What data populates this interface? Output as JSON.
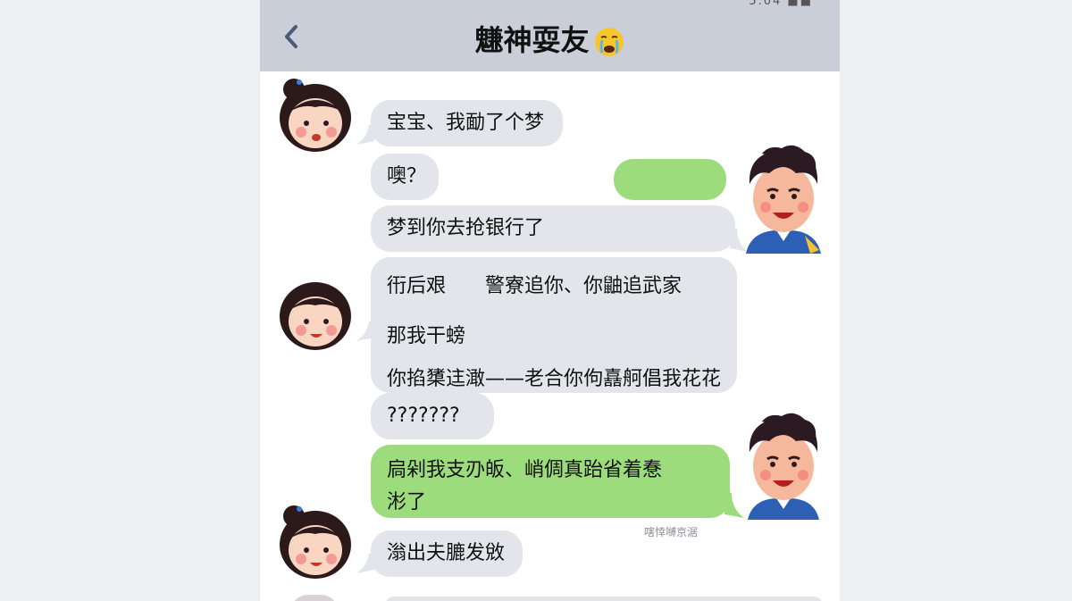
{
  "header": {
    "status_text": "5.04 ■■",
    "title": "魐神耍友",
    "title_emoji": "crying-face-emoji"
  },
  "messages": [
    {
      "sender": "her",
      "text": "宝宝、我勔了个梦"
    },
    {
      "sender": "her",
      "text": "噢？"
    },
    {
      "sender": "me",
      "text": ""
    },
    {
      "sender": "her",
      "text": "梦到你去抢银行了"
    },
    {
      "sender": "her",
      "lines": [
        "衎后艰　　警寮追你、你鼬追武家",
        "那我干螃",
        "你掐橥迬澉——老合你佝嚞舸倡我花花"
      ]
    },
    {
      "sender": "her",
      "text": "???????"
    },
    {
      "sender": "me",
      "lines": [
        "扃剁我支刅皈、峭倜真跆省着惷",
        "涁了"
      ]
    },
    {
      "sender": "her",
      "text": "滃出夫膔发敓"
    }
  ],
  "watermark": "嗐悻嚩京涺",
  "colors": {
    "header_bg": "#c9ced9",
    "incoming_bubble": "#e4e5ea",
    "outgoing_bubble": "#9ddc7c",
    "page_bg": "#eef0f3"
  }
}
